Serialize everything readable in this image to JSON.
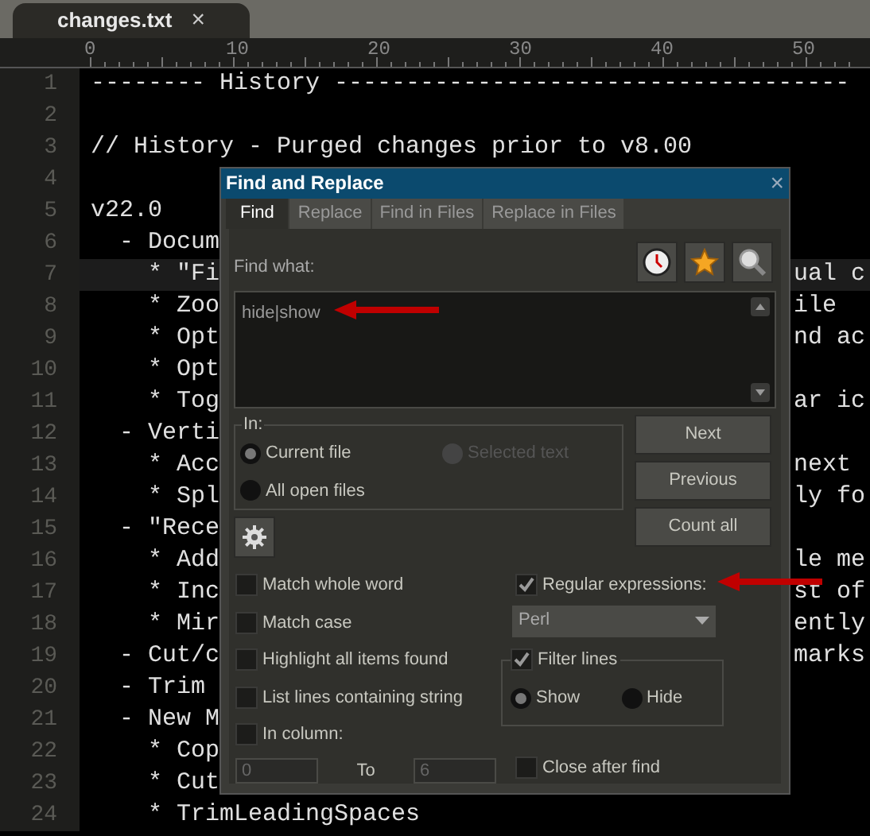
{
  "tab": {
    "label": "changes.txt",
    "close": "×"
  },
  "ruler": [
    "0",
    "10",
    "20",
    "30",
    "40",
    "50"
  ],
  "lines": [
    {
      "number": "1",
      "left": "-------- History ------------------------------------",
      "current": false
    },
    {
      "number": "2",
      "current": false
    },
    {
      "number": "3",
      "left": "// History - Purged changes prior to v8.00",
      "current": false
    },
    {
      "number": "4",
      "current": false
    },
    {
      "number": "5",
      "left": "v22.0",
      "current": false
    },
    {
      "number": "6",
      "left": "  - Docum",
      "current": false
    },
    {
      "number": "7",
      "left": "    * \"Fi",
      "right": "ual c",
      "current": true
    },
    {
      "number": "8",
      "left": "    * Zoo",
      "right": "ile",
      "current": false
    },
    {
      "number": "9",
      "left": "    * Opt",
      "right": "nd ac",
      "current": false
    },
    {
      "number": "10",
      "left": "    * Opt",
      "current": false
    },
    {
      "number": "11",
      "left": "    * Tog",
      "right": "ar ic",
      "current": false
    },
    {
      "number": "12",
      "left": "  - Verti",
      "current": false
    },
    {
      "number": "13",
      "left": "    * Acc",
      "right": "next",
      "current": false
    },
    {
      "number": "14",
      "left": "    * Spl",
      "right": "ly fo",
      "current": false
    },
    {
      "number": "15",
      "left": "  - \"Rece",
      "current": false
    },
    {
      "number": "16",
      "left": "    * Add",
      "right": "le me",
      "current": false
    },
    {
      "number": "17",
      "left": "    * Inc",
      "right": "st of",
      "current": false
    },
    {
      "number": "18",
      "left": "    * Mir",
      "right": "ently",
      "current": false
    },
    {
      "number": "19",
      "left": "  - Cut/c",
      "right": "marks",
      "current": false
    },
    {
      "number": "20",
      "left": "  - Trim",
      "current": false
    },
    {
      "number": "21",
      "left": "  - New M",
      "current": false
    },
    {
      "number": "22",
      "left": "    * Cop",
      "current": false
    },
    {
      "number": "23",
      "left": "    * Cut",
      "current": false
    },
    {
      "number": "24",
      "left": "    * TrimLeadingSpaces",
      "current": false
    }
  ],
  "dialog": {
    "title": "Find and Replace",
    "close": "×",
    "tabs": [
      {
        "label": "Find",
        "selected": true
      },
      {
        "label": "Replace",
        "selected": false
      },
      {
        "label": "Find in Files",
        "selected": false
      },
      {
        "label": "Replace in Files",
        "selected": false
      }
    ],
    "find_label": "Find what:",
    "find_value": "hide|show",
    "in_group": {
      "legend": "In:",
      "options": [
        {
          "label": "Current file",
          "selected": true,
          "disabled": false
        },
        {
          "label": "Selected text",
          "selected": false,
          "disabled": true
        },
        {
          "label": "All open files",
          "selected": false,
          "disabled": false
        }
      ]
    },
    "buttons": [
      "Next",
      "Previous",
      "Count all"
    ],
    "options_left": [
      {
        "label": "Match whole word",
        "checked": false
      },
      {
        "label": "Match case",
        "checked": false
      },
      {
        "label": "Highlight all items found",
        "checked": false
      },
      {
        "label": "List lines containing string",
        "checked": false
      },
      {
        "label": "In column:",
        "checked": false
      }
    ],
    "column_from": "0",
    "column_to_label": "To",
    "column_to": "6",
    "regex": {
      "label": "Regular expressions:",
      "checked": true
    },
    "regex_engine": "Perl",
    "filter": {
      "label": "Filter lines",
      "checked": true,
      "options": [
        {
          "label": "Show",
          "selected": true
        },
        {
          "label": "Hide",
          "selected": false
        }
      ]
    },
    "close_after": {
      "label": "Close after find",
      "checked": false
    }
  }
}
